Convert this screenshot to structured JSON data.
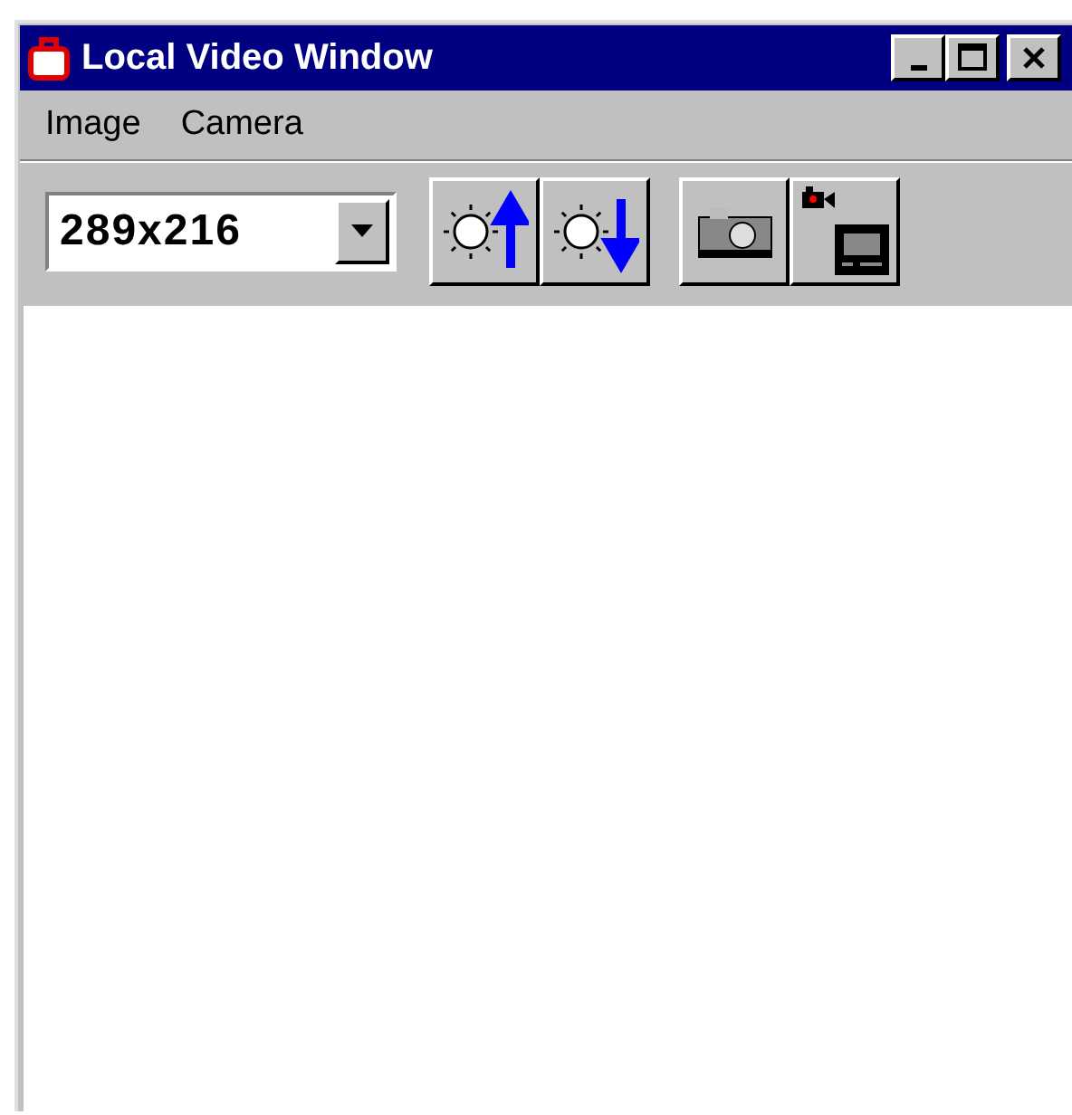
{
  "window": {
    "title": "Local Video Window"
  },
  "menu": [
    "Image",
    "Camera"
  ],
  "toolbar": {
    "size_select": {
      "value": "289x216"
    }
  }
}
